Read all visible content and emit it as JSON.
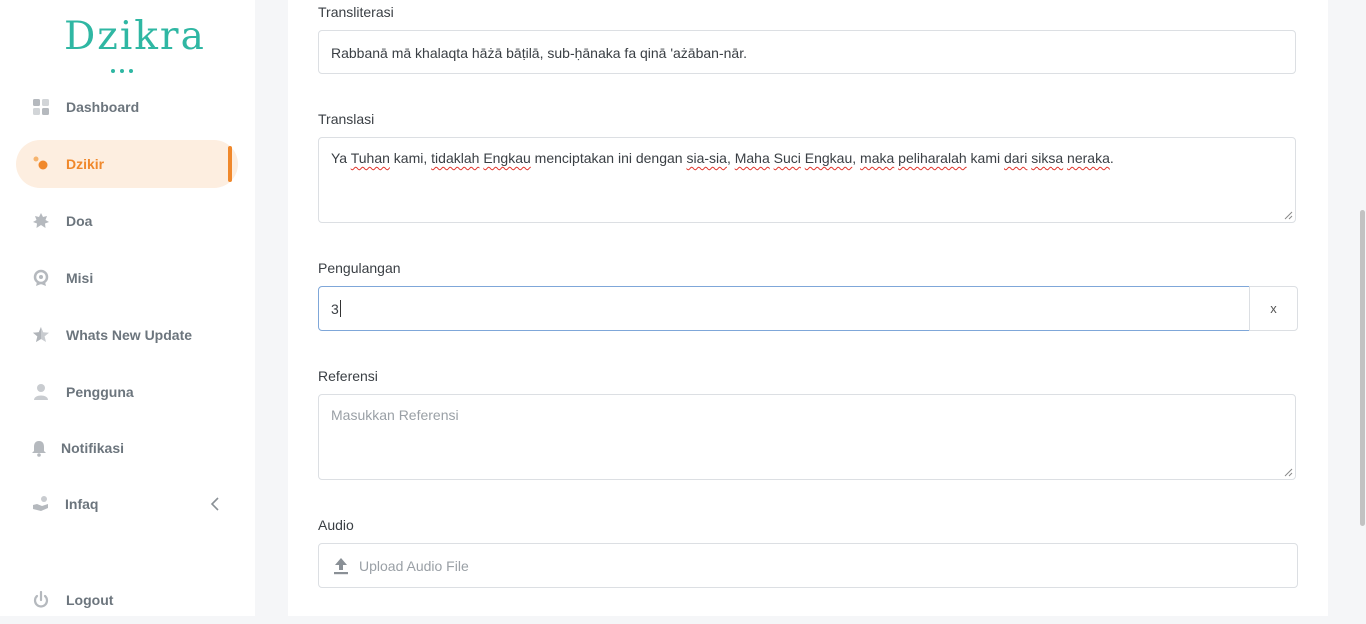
{
  "brand": {
    "name": "Dzikra",
    "color": "#2fb7a3"
  },
  "sidebar": {
    "items": [
      {
        "label": "Dashboard",
        "icon": "dashboard-icon"
      },
      {
        "label": "Dzikir",
        "icon": "dzikir-icon",
        "active": true
      },
      {
        "label": "Doa",
        "icon": "doa-icon"
      },
      {
        "label": "Misi",
        "icon": "mission-icon"
      },
      {
        "label": "Whats New Update",
        "icon": "star-icon"
      },
      {
        "label": "Pengguna",
        "icon": "user-icon"
      },
      {
        "label": "Notifikasi",
        "icon": "bell-icon"
      },
      {
        "label": "Infaq",
        "icon": "infaq-icon"
      }
    ],
    "logout_label": "Logout",
    "accent": "#f0882b"
  },
  "form": {
    "transliterasi": {
      "label": "Transliterasi",
      "value": "Rabbanā mā khalaqta hāżā bāṭilā, sub-ḥānaka fa qinā 'ażāban-nār."
    },
    "translasi": {
      "label": "Translasi",
      "value_parts": [
        "Ya ",
        "Tuhan",
        " kami, ",
        "tidaklah",
        " ",
        "Engkau",
        " menciptakan ini dengan ",
        "sia-sia",
        ", ",
        "Maha",
        " ",
        "Suci",
        " ",
        "Engkau",
        ", ",
        "maka",
        " ",
        "peliharalah",
        " kami ",
        "dari",
        " ",
        "siksa",
        " ",
        "neraka",
        "."
      ]
    },
    "pengulangan": {
      "label": "Pengulangan",
      "value": "3",
      "clear_label": "x"
    },
    "referensi": {
      "label": "Referensi",
      "placeholder": "Masukkan Referensi"
    },
    "audio": {
      "label": "Audio",
      "upload_label": "Upload Audio File"
    }
  }
}
